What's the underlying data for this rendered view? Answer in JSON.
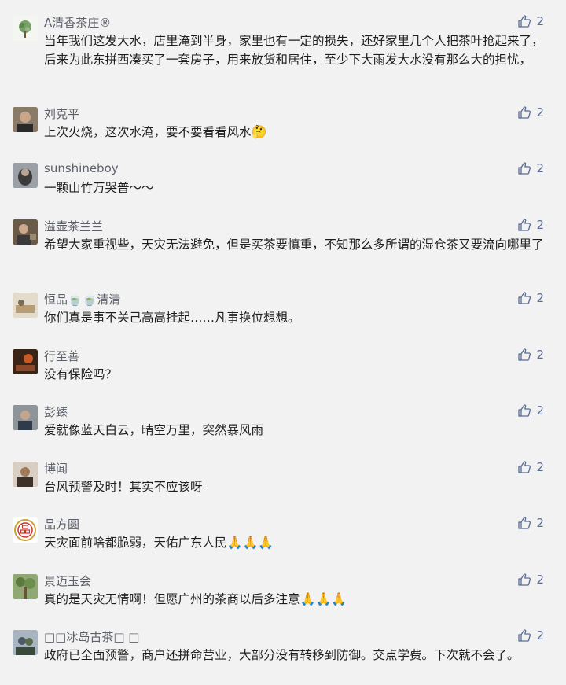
{
  "comments": [
    {
      "name": "A清香茶庄®",
      "text": "当年我们这发大水，店里淹到半身，家里也有一定的损失，还好家里几个人把茶叶抢起来了，后来为此东拼西凑买了一套房子，用来放货和居住，至少下大雨发大水没有那么大的担忧，",
      "likes": "2",
      "emoji": "",
      "avatar_color": "#e9f0e4"
    },
    {
      "name": "刘克平",
      "text": "上次火烧，这次水淹，要不要看看风水",
      "likes": "2",
      "emoji": "🤔",
      "avatar_color": "#6b5a4a"
    },
    {
      "name": "sunshineboy",
      "text": "一颗山竹万哭普～～",
      "likes": "2",
      "emoji": "",
      "avatar_color": "#7a7f86"
    },
    {
      "name": "溢壶茶兰兰",
      "text": "希望大家重视些，天灾无法避免，但是买茶要慎重，不知那么多所谓的湿仓茶又要流向哪里了",
      "likes": "2",
      "emoji": "",
      "avatar_color": "#5a4c3c"
    },
    {
      "name": "恒品🍵🍵清清",
      "text": "你们真是事不关己高高挂起……凡事换位想想。",
      "likes": "2",
      "emoji": "",
      "avatar_color": "#cfc6b4"
    },
    {
      "name": "行至善",
      "text": "没有保险吗？",
      "likes": "2",
      "emoji": "",
      "avatar_color": "#7a3a22"
    },
    {
      "name": "彭臻",
      "text": "爱就像蓝天白云，晴空万里，突然暴风雨",
      "likes": "2",
      "emoji": "",
      "avatar_color": "#6b6f74"
    },
    {
      "name": "博闻",
      "text": "台风预警及时！其实不应该呀",
      "likes": "2",
      "emoji": "",
      "avatar_color": "#4e3e30"
    },
    {
      "name": "品方圆",
      "text": "天灾面前啥都脆弱，天佑广东人民",
      "likes": "2",
      "emoji": "🙏🙏🙏",
      "avatar_color": "#ffffff"
    },
    {
      "name": "景迈玉会",
      "text": "真的是天灾无情啊！但愿广州的茶商以后多注意",
      "likes": "2",
      "emoji": "🙏🙏🙏",
      "avatar_color": "#6e8a54"
    },
    {
      "name": "□□冰岛古茶□ □",
      "text": "政府已全面预警，商户还拼命营业，大部分没有转移到防御。交点学费。下次就不会了。",
      "likes": "2",
      "emoji": "",
      "avatar_color": "#7b8794"
    }
  ]
}
